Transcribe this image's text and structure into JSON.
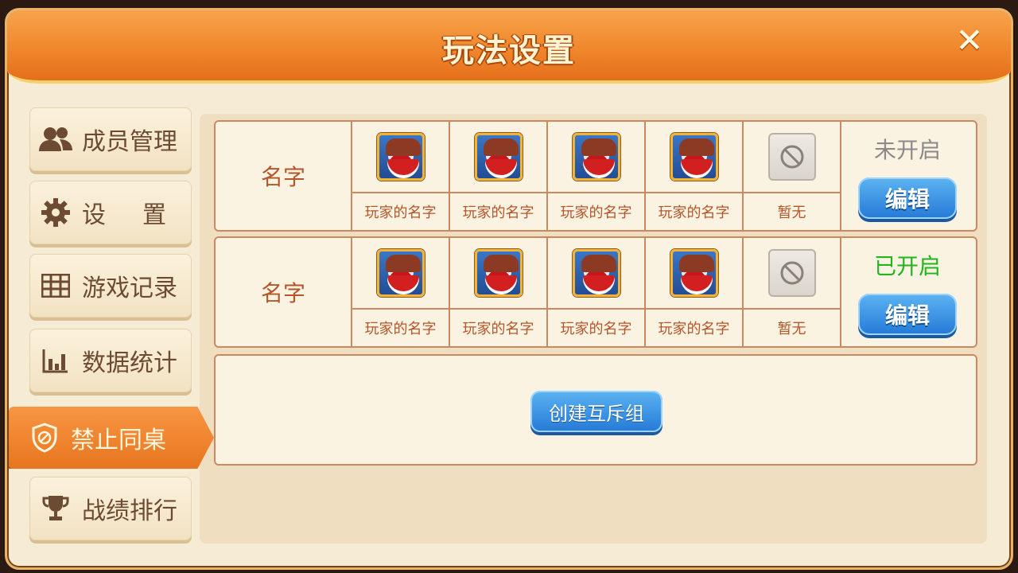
{
  "title": "玩法设置",
  "colors": {
    "accent_orange": "#f0872c",
    "status_off": "#8a8a8a",
    "status_on": "#22b51f",
    "text_brown": "#b4552a",
    "button_blue": "#2479d6"
  },
  "sidebar": {
    "items": [
      {
        "label": "成员管理",
        "icon": "members-icon"
      },
      {
        "label": "设　置",
        "icon": "gear-icon"
      },
      {
        "label": "游戏记录",
        "icon": "grid-icon"
      },
      {
        "label": "数据统计",
        "icon": "bar-chart-icon"
      },
      {
        "label": "禁止同桌",
        "icon": "ban-shield-icon",
        "active": true
      },
      {
        "label": "战绩排行",
        "icon": "trophy-icon"
      }
    ]
  },
  "groups": [
    {
      "name": "名字",
      "players": [
        "玩家的名字",
        "玩家的名字",
        "玩家的名字",
        "玩家的名字"
      ],
      "empty_slot_label": "暂无",
      "status": "未开启",
      "status_color": "#8a8a8a",
      "edit_label": "编辑"
    },
    {
      "name": "名字",
      "players": [
        "玩家的名字",
        "玩家的名字",
        "玩家的名字",
        "玩家的名字"
      ],
      "empty_slot_label": "暂无",
      "status": "已开启",
      "status_color": "#22b51f",
      "edit_label": "编辑"
    }
  ],
  "create_button_label": "创建互斥组"
}
